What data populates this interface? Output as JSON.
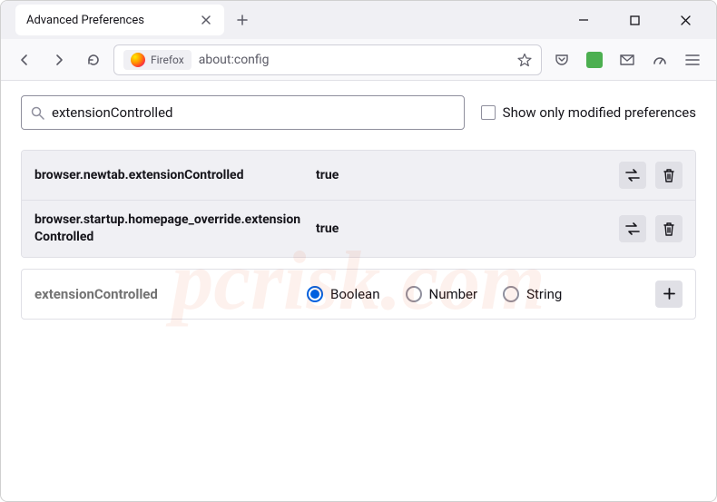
{
  "tab": {
    "title": "Advanced Preferences"
  },
  "urlbar": {
    "firefox_label": "Firefox",
    "url": "about:config"
  },
  "search": {
    "value": "extensionControlled"
  },
  "show_modified_label": "Show only modified preferences",
  "prefs": [
    {
      "name": "browser.newtab.extensionControlled",
      "value": "true"
    },
    {
      "name": "browser.startup.homepage_override.extensionControlled",
      "value": "true"
    }
  ],
  "newpref": {
    "name": "extensionControlled",
    "types": [
      "Boolean",
      "Number",
      "String"
    ],
    "selected": "Boolean"
  },
  "watermark": "pcrisk.com"
}
